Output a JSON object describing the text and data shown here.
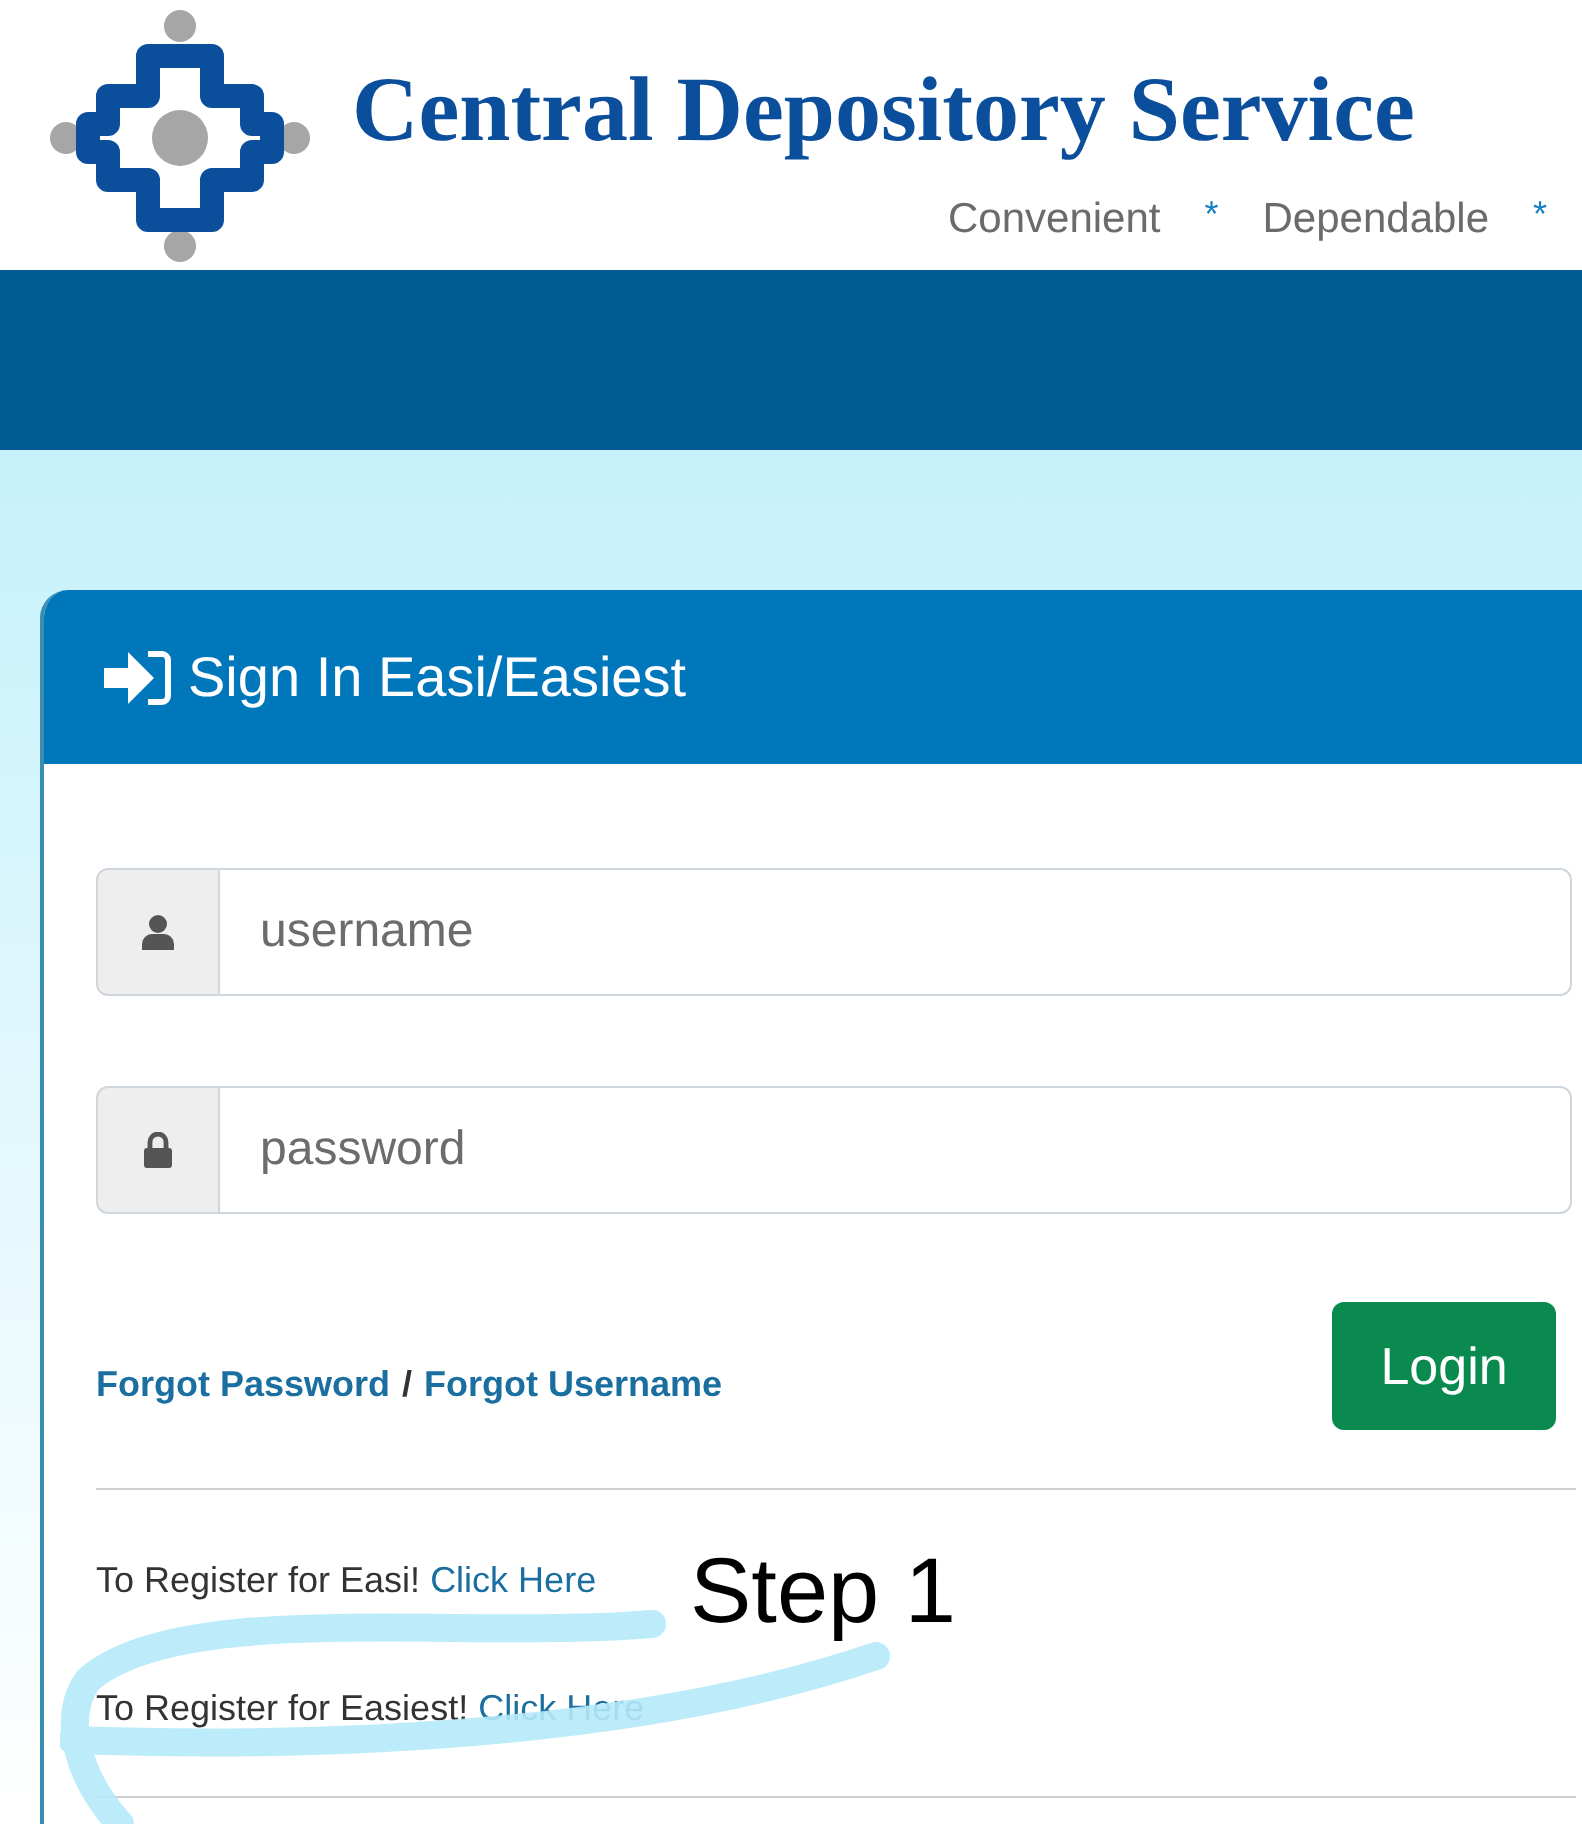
{
  "header": {
    "title": "Central Depository Service",
    "tagline": [
      {
        "kind": "word",
        "text": "Convenient"
      },
      {
        "kind": "star",
        "text": "*"
      },
      {
        "kind": "word",
        "text": "Dependable"
      },
      {
        "kind": "star",
        "text": "*"
      }
    ]
  },
  "card": {
    "title": "Sign In Easi/Easiest",
    "fields": [
      {
        "kind": "user",
        "placeholder": "username"
      },
      {
        "kind": "lock",
        "placeholder": "password"
      }
    ],
    "links": [
      {
        "text": "Forgot Password"
      },
      {
        "text": "/",
        "kind": "separator"
      },
      {
        "text": "Forgot Username"
      }
    ],
    "login_button": "Login",
    "register": [
      {
        "text": "To Register for Easi!",
        "link": "Click Here"
      },
      {
        "text": "To Register for Easiest!",
        "link": "Click Here"
      }
    ]
  },
  "annotation": {
    "text": "Step 1"
  }
}
